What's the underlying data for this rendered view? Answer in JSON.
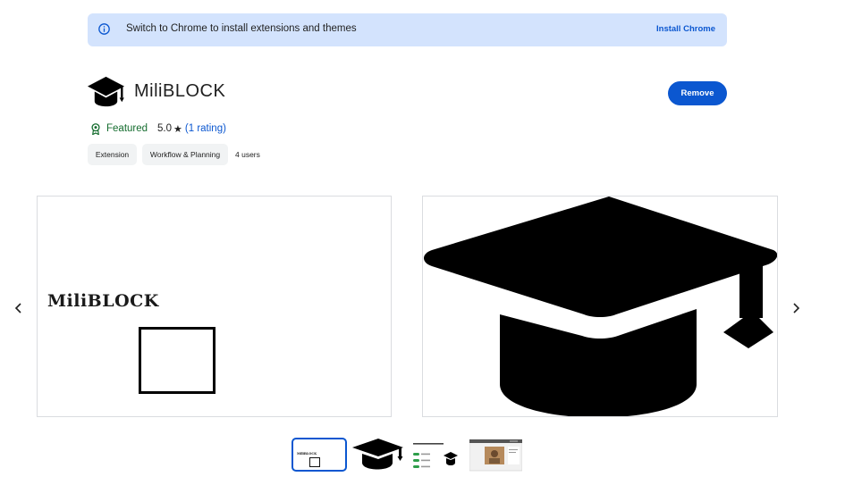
{
  "banner": {
    "text": "Switch to Chrome to install extensions and themes",
    "link_label": "Install Chrome",
    "icon": "info-icon"
  },
  "extension": {
    "title": "MiliBLOCK",
    "logo_icon": "graduation-cap-icon",
    "remove_label": "Remove",
    "featured_label": "Featured",
    "rating": "5.0",
    "rating_count_label": "(1 rating)",
    "chips": [
      "Extension",
      "Workflow & Planning"
    ],
    "users_label": "4 users"
  },
  "carousel": {
    "slide_1_title": "MiliBLOCK",
    "prev_icon": "chevron-left-icon",
    "next_icon": "chevron-right-icon",
    "selected_thumbnail": 1,
    "thumbnail_count": 4
  },
  "colors": {
    "accent": "#0b57d0",
    "banner_bg": "#d3e3fd",
    "featured_green": "#146c2e",
    "chip_bg": "#f1f3f4"
  }
}
